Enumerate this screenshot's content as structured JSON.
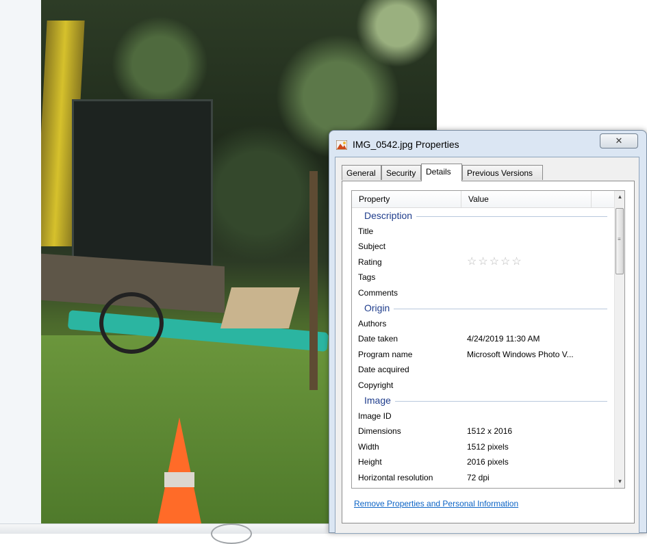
{
  "dialog": {
    "title": "IMG_0542.jpg Properties",
    "close_glyph": "✕",
    "tabs": [
      "General",
      "Security",
      "Details",
      "Previous Versions"
    ],
    "active_tab": "Details",
    "columns": {
      "property": "Property",
      "value": "Value"
    },
    "groups": {
      "description": "Description",
      "origin": "Origin",
      "image": "Image"
    },
    "rows": {
      "title": "Title",
      "subject": "Subject",
      "rating": "Rating",
      "rating_stars": "☆☆☆☆☆",
      "tags": "Tags",
      "comments": "Comments",
      "authors": "Authors",
      "date_taken": "Date taken",
      "date_taken_value": "4/24/2019 11:30 AM",
      "program_name": "Program name",
      "program_name_value": "Microsoft Windows Photo V...",
      "date_acquired": "Date acquired",
      "copyright": "Copyright",
      "image_id": "Image ID",
      "dimensions": "Dimensions",
      "dimensions_value": "1512 x 2016",
      "width": "Width",
      "width_value": "1512 pixels",
      "height": "Height",
      "height_value": "2016 pixels",
      "horizontal_resolution": "Horizontal resolution",
      "horizontal_resolution_value": "72 dpi"
    },
    "remove_link": "Remove Properties and Personal Information"
  },
  "icons": {
    "file": "image-file-icon",
    "close": "close-icon",
    "scroll_up": "scroll-up-icon",
    "scroll_down": "scroll-down-icon"
  },
  "colors": {
    "accent_group": "#1f3d8c",
    "link": "#0b63c5",
    "frame": "#dbe6f3"
  }
}
